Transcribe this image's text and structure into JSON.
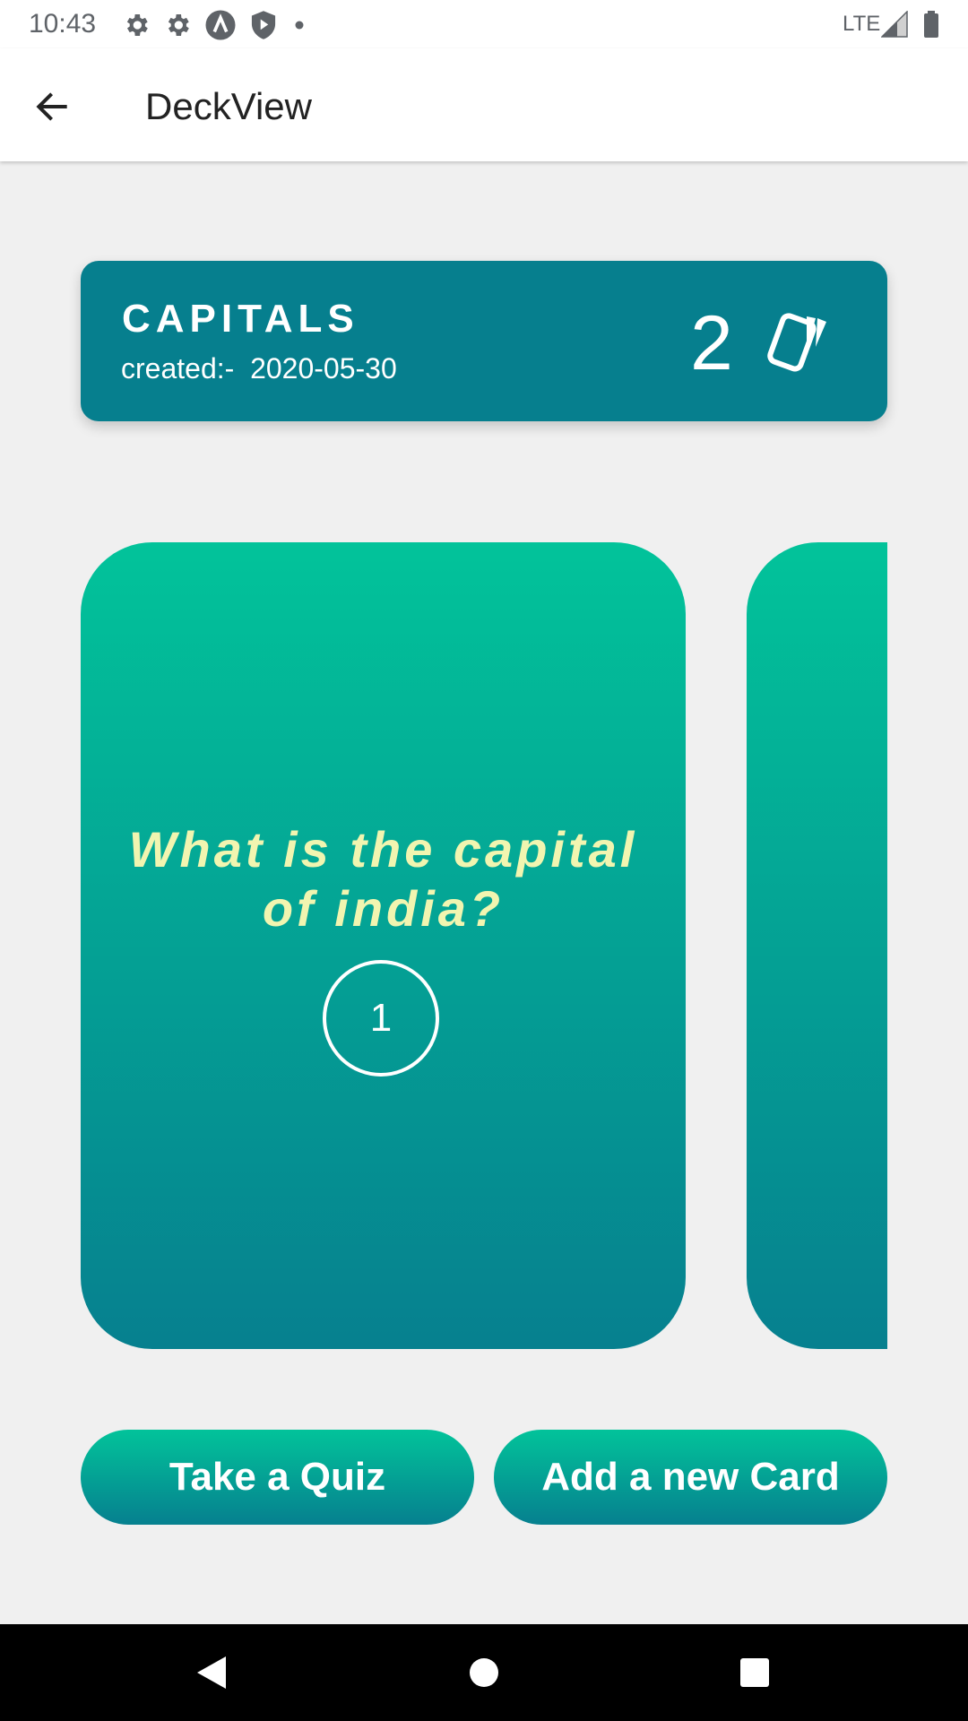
{
  "status_bar": {
    "time": "10:43",
    "network": "LTE",
    "icons": [
      "gear-icon",
      "gear-icon",
      "a-icon",
      "shield-play-icon",
      "dot-icon",
      "signal-icon",
      "battery-icon"
    ]
  },
  "app_bar": {
    "title": "DeckView",
    "back_icon": "arrow-left-icon"
  },
  "deck": {
    "name": "CAPITALS",
    "created": "created:-  2020-05-30",
    "card_count": "2",
    "count_icon": "cards-icon",
    "color": "#067f8e"
  },
  "cards": [
    {
      "question": "What is the capital of india?",
      "number": "1"
    }
  ],
  "buttons": {
    "take_quiz": "Take a Quiz",
    "add_card": "Add a new Card"
  },
  "colors": {
    "gradient_top": "#02c39a",
    "gradient_bottom": "#06808f",
    "question_text": "#f1f5b0",
    "background": "#f0f0f0"
  },
  "nav_bar": {
    "icons": [
      "back-triangle-icon",
      "home-circle-icon",
      "recents-square-icon"
    ]
  }
}
